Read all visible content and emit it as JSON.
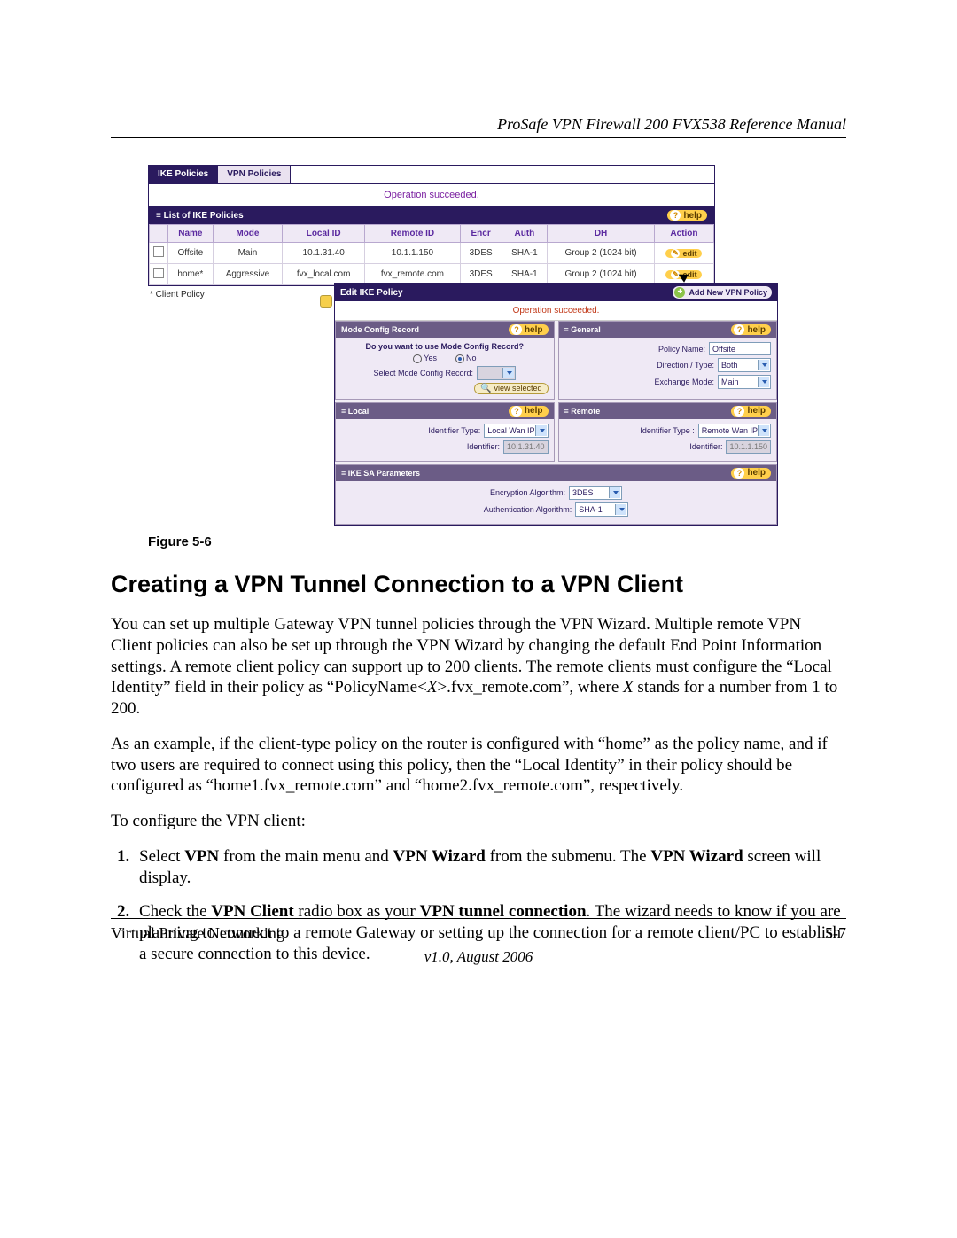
{
  "header": {
    "running_title": "ProSafe VPN Firewall 200 FVX538 Reference Manual"
  },
  "figure": {
    "caption": "Figure 5-6",
    "tabs": {
      "ike": "IKE Policies",
      "vpn": "VPN Policies"
    },
    "op_msg": "Operation succeeded.",
    "list_title": "List of IKE Policies",
    "help_label": "help",
    "columns": {
      "name": "Name",
      "mode": "Mode",
      "local_id": "Local ID",
      "remote_id": "Remote ID",
      "encr": "Encr",
      "auth": "Auth",
      "dh": "DH",
      "action": "Action"
    },
    "rows": [
      {
        "name": "Offsite",
        "mode": "Main",
        "local_id": "10.1.31.40",
        "remote_id": "10.1.1.150",
        "encr": "3DES",
        "auth": "SHA-1",
        "dh": "Group 2 (1024 bit)",
        "action": "edit"
      },
      {
        "name": "home*",
        "mode": "Aggressive",
        "local_id": "fvx_local.com",
        "remote_id": "fvx_remote.com",
        "encr": "3DES",
        "auth": "SHA-1",
        "dh": "Group 2 (1024 bit)",
        "action": "edit"
      }
    ],
    "client_note": "* Client Policy",
    "edit": {
      "title": "Edit IKE Policy",
      "add_vpn": "Add New VPN Policy",
      "op_msg": "Operation succeeded.",
      "mode_config": {
        "title": "Mode Config Record",
        "question": "Do you want to use Mode Config Record?",
        "yes": "Yes",
        "no": "No",
        "select_label": "Select Mode Config Record:",
        "view_btn": "view selected"
      },
      "general": {
        "title": "General",
        "policy_name_label": "Policy Name:",
        "policy_name_value": "Offsite",
        "direction_label": "Direction / Type:",
        "direction_value": "Both",
        "exchange_label": "Exchange Mode:",
        "exchange_value": "Main"
      },
      "local": {
        "title": "Local",
        "id_type_label": "Identifier Type:",
        "id_type_value": "Local Wan IP",
        "identifier_label": "Identifier:",
        "identifier_value": "10.1.31.40"
      },
      "remote": {
        "title": "Remote",
        "id_type_label": "Identifier Type :",
        "id_type_value": "Remote Wan IP",
        "identifier_label": "Identifier:",
        "identifier_value": "10.1.1.150"
      },
      "sa": {
        "title": "IKE SA Parameters",
        "enc_label": "Encryption Algorithm:",
        "enc_value": "3DES",
        "auth_label": "Authentication Algorithm:",
        "auth_value": "SHA-1"
      }
    }
  },
  "section": {
    "heading": "Creating a VPN Tunnel Connection to a VPN Client"
  },
  "para1": {
    "t1": "You can set up multiple Gateway VPN tunnel policies through the VPN Wizard. Multiple remote VPN Client policies can also be set up through the VPN Wizard by changing the default End Point Information settings. A remote client policy can support up to 200 clients. The remote clients must configure the “Local Identity” field in their policy as “PolicyName<",
    "x1": "X",
    "t2": ">.fvx_remote.com”, where ",
    "x2": "X",
    "t3": " stands for a number from 1 to 200."
  },
  "para2": "As an example, if the client-type policy on the router is configured with “home” as the policy name, and if two users are required to connect using this policy, then the “Local Identity” in their policy should be configured as “home1.fvx_remote.com” and “home2.fvx_remote.com”, respectively.",
  "para3": "To configure the VPN client:",
  "steps": {
    "s1a": "Select ",
    "s1b": "VPN",
    "s1c": " from the main menu and ",
    "s1d": "VPN Wizard",
    "s1e": " from the submenu. The ",
    "s1f": "VPN Wizard",
    "s1g": " screen will display.",
    "s2a": "Check the ",
    "s2b": "VPN Client",
    "s2c": " radio box as your ",
    "s2d": "VPN tunnel connection",
    "s2e": ". The wizard needs to know if you are planning to connect to a remote Gateway or setting up the connection for a remote client/PC to establish a secure connection to this device."
  },
  "footer": {
    "left": "Virtual Private Networking",
    "right": "5-7",
    "version": "v1.0, August 2006"
  }
}
